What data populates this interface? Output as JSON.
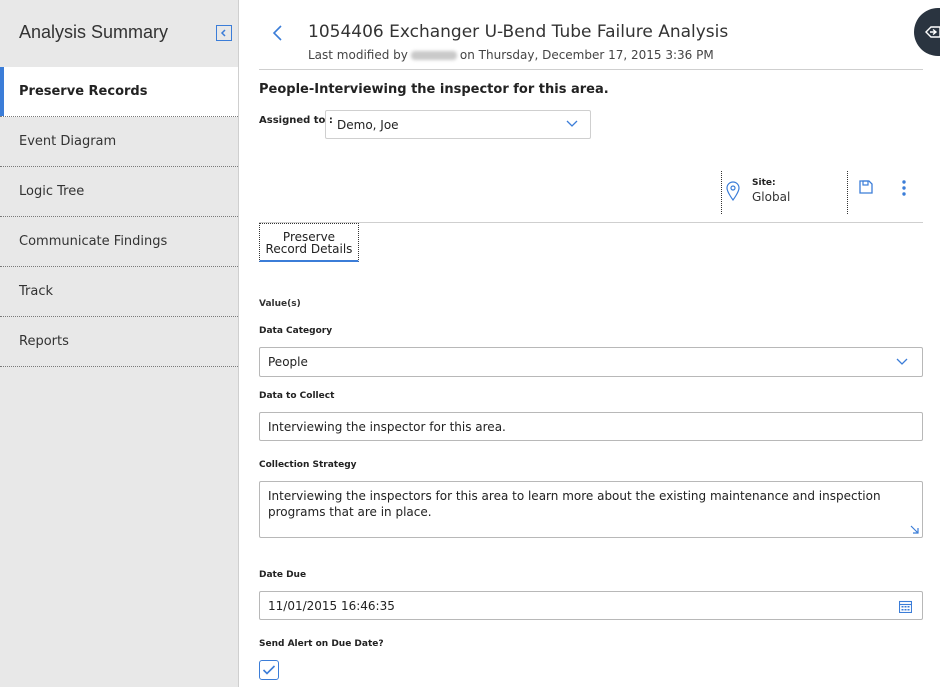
{
  "sidebar": {
    "title": "Analysis Summary",
    "items": [
      {
        "label": "Preserve Records",
        "active": true
      },
      {
        "label": "Event Diagram"
      },
      {
        "label": "Logic Tree"
      },
      {
        "label": "Communicate Findings"
      },
      {
        "label": "Track"
      },
      {
        "label": "Reports"
      }
    ]
  },
  "header": {
    "title": "1054406 Exchanger U-Bend Tube Failure Analysis",
    "modified_prefix": "Last modified by",
    "modified_suffix": "on Thursday, December 17, 2015 3:36 PM"
  },
  "record": {
    "heading": "People-Interviewing the inspector for this area.",
    "assigned_label": "Assigned to :",
    "assigned_value": "Demo, Joe"
  },
  "toolbar": {
    "site_label": "Site:",
    "site_value": "Global"
  },
  "tab": {
    "line1": "Preserve",
    "line2": "Record Details"
  },
  "form": {
    "section": "Value(s)",
    "data_category_label": "Data Category",
    "data_category_value": "People",
    "data_to_collect_label": "Data to Collect",
    "data_to_collect_value": "Interviewing the inspector for this area.",
    "collection_strategy_label": "Collection Strategy",
    "collection_strategy_value": "Interviewing the inspectors for this area to learn more about the existing maintenance and inspection programs that are in place.",
    "date_due_label": "Date Due",
    "date_due_value": "11/01/2015 16:46:35",
    "send_alert_label": "Send Alert on Due Date?",
    "send_alert_checked": true
  },
  "colors": {
    "accent": "#3b7dd8",
    "sidebar_bg": "#e8e8e8",
    "toggle_bg": "#2a3440"
  }
}
